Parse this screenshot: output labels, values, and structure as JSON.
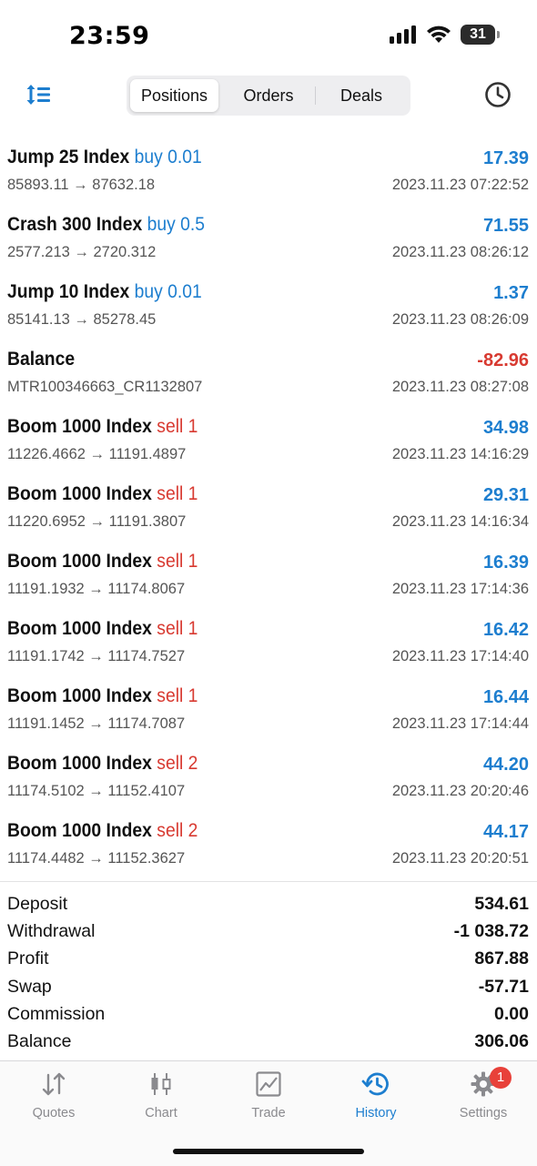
{
  "status_bar": {
    "time": "23:59",
    "battery": "31"
  },
  "tabs_segment": {
    "positions": "Positions",
    "orders": "Orders",
    "deals": "Deals",
    "active": "positions"
  },
  "deals": [
    {
      "title": "Jump 25 Index",
      "side": "buy 0.01",
      "side_color": "blue",
      "prices": "85893.11 → 87632.18",
      "profit": "17.39",
      "profit_color": "blue",
      "time": "2023.11.23 07:22:52"
    },
    {
      "title": "Crash 300 Index",
      "side": "buy 0.5",
      "side_color": "blue",
      "prices": "2577.213 → 2720.312",
      "profit": "71.55",
      "profit_color": "blue",
      "time": "2023.11.23 08:26:12"
    },
    {
      "title": "Jump 10 Index",
      "side": "buy 0.01",
      "side_color": "blue",
      "prices": "85141.13 → 85278.45",
      "profit": "1.37",
      "profit_color": "blue",
      "time": "2023.11.23 08:26:09"
    },
    {
      "title": "Balance",
      "side": "",
      "side_color": "blue",
      "prices": "MTR100346663_CR1132807",
      "profit": "-82.96",
      "profit_color": "red",
      "time": "2023.11.23 08:27:08"
    },
    {
      "title": "Boom 1000 Index",
      "side": "sell 1",
      "side_color": "red",
      "prices": "11226.4662 → 11191.4897",
      "profit": "34.98",
      "profit_color": "blue",
      "time": "2023.11.23 14:16:29"
    },
    {
      "title": "Boom 1000 Index",
      "side": "sell 1",
      "side_color": "red",
      "prices": "11220.6952 → 11191.3807",
      "profit": "29.31",
      "profit_color": "blue",
      "time": "2023.11.23 14:16:34"
    },
    {
      "title": "Boom 1000 Index",
      "side": "sell 1",
      "side_color": "red",
      "prices": "11191.1932 → 11174.8067",
      "profit": "16.39",
      "profit_color": "blue",
      "time": "2023.11.23 17:14:36"
    },
    {
      "title": "Boom 1000 Index",
      "side": "sell 1",
      "side_color": "red",
      "prices": "11191.1742 → 11174.7527",
      "profit": "16.42",
      "profit_color": "blue",
      "time": "2023.11.23 17:14:40"
    },
    {
      "title": "Boom 1000 Index",
      "side": "sell 1",
      "side_color": "red",
      "prices": "11191.1452 → 11174.7087",
      "profit": "16.44",
      "profit_color": "blue",
      "time": "2023.11.23 17:14:44"
    },
    {
      "title": "Boom 1000 Index",
      "side": "sell 2",
      "side_color": "red",
      "prices": "11174.5102 → 11152.4107",
      "profit": "44.20",
      "profit_color": "blue",
      "time": "2023.11.23 20:20:46"
    },
    {
      "title": "Boom 1000 Index",
      "side": "sell 2",
      "side_color": "red",
      "prices": "11174.4482 → 11152.3627",
      "profit": "44.17",
      "profit_color": "blue",
      "time": "2023.11.23 20:20:51"
    }
  ],
  "summary": [
    {
      "label": "Deposit",
      "value": "534.61"
    },
    {
      "label": "Withdrawal",
      "value": "-1 038.72"
    },
    {
      "label": "Profit",
      "value": "867.88"
    },
    {
      "label": "Swap",
      "value": "-57.71"
    },
    {
      "label": "Commission",
      "value": "0.00"
    },
    {
      "label": "Balance",
      "value": "306.06"
    }
  ],
  "tabbar": {
    "quotes": "Quotes",
    "chart": "Chart",
    "trade": "Trade",
    "history": "History",
    "settings": "Settings",
    "settings_badge": "1",
    "active": "history"
  },
  "colors": {
    "accent": "#1d7ecf",
    "negative": "#d83a31",
    "badge": "#e8413a"
  }
}
